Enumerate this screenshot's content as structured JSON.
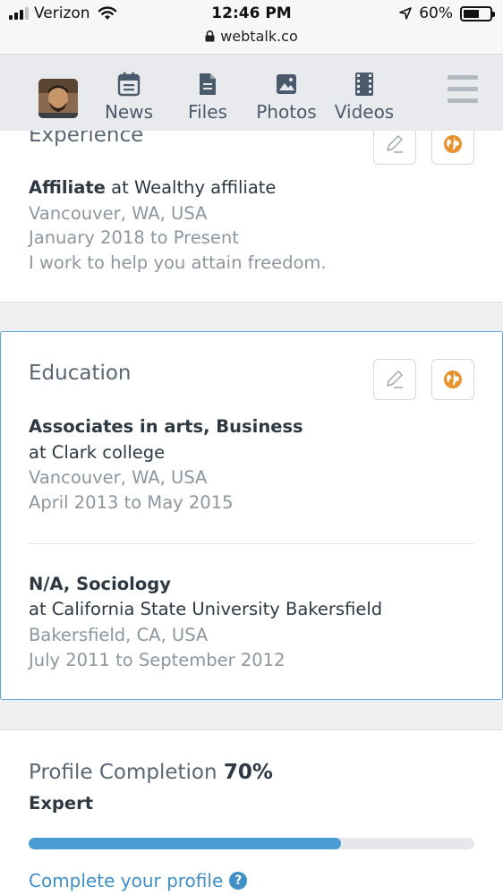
{
  "status_bar": {
    "carrier": "Verizon",
    "time": "12:46 PM",
    "battery": "60%",
    "battery_level": 0.6,
    "url": "webtalk.co"
  },
  "nav": {
    "items": [
      {
        "label": "News",
        "icon": "news-icon"
      },
      {
        "label": "Files",
        "icon": "file-icon"
      },
      {
        "label": "Photos",
        "icon": "photo-icon"
      },
      {
        "label": "Videos",
        "icon": "video-icon"
      }
    ]
  },
  "experience": {
    "title": "Experience",
    "entries": [
      {
        "role": "Affiliate",
        "at_text": "at",
        "company": "Wealthy affiliate",
        "location": "Vancouver, WA, USA",
        "dates": "January 2018 to Present",
        "description": "I work to help you attain freedom."
      }
    ]
  },
  "education": {
    "title": "Education",
    "entries": [
      {
        "degree": "Associates in arts, Business",
        "school": "at Clark college",
        "location": "Vancouver, WA, USA",
        "dates": "April 2013 to May 2015"
      },
      {
        "degree": "N/A, Sociology",
        "school": "at California State University Bakersfield",
        "location": "Bakersfield, CA, USA",
        "dates": "July 2011 to September 2012"
      }
    ]
  },
  "profile": {
    "title": "Profile Completion",
    "percent_label": "70%",
    "progress": 0.7,
    "level": "Expert",
    "link": "Complete your profile",
    "help_glyph": "?"
  },
  "colors": {
    "accent": "#4a9ad3",
    "globe": "#e8912d",
    "card_border": "#5aa4d6"
  }
}
